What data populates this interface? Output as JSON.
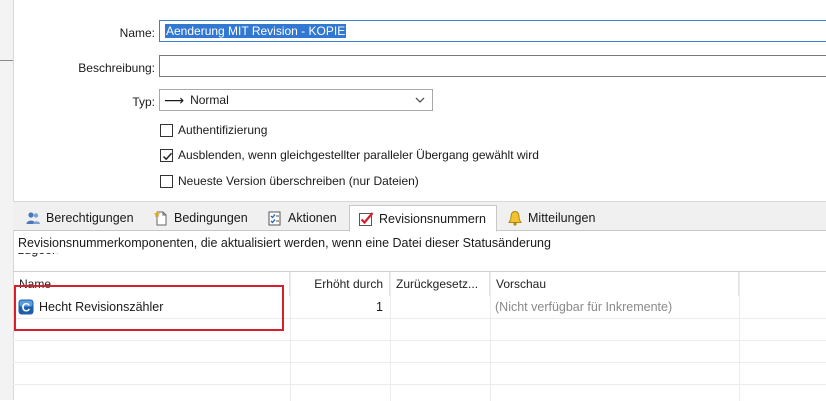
{
  "form": {
    "name_label": "Name:",
    "name_value": "Aenderung MIT Revision - KOPIE",
    "description_label": "Beschreibung:",
    "description_value": "",
    "type_label": "Typ:",
    "type_value": "Normal",
    "checkboxes": [
      {
        "label": "Authentifizierung",
        "checked": false
      },
      {
        "label": "Ausblenden, wenn gleichgestellter paralleler Übergang gewählt wird",
        "checked": true
      },
      {
        "label": "Neueste Version überschreiben (nur Dateien)",
        "checked": false
      }
    ]
  },
  "tabs": [
    {
      "label": "Berechtigungen",
      "icon": "people-icon"
    },
    {
      "label": "Bedingungen",
      "icon": "document-star-icon"
    },
    {
      "label": "Aktionen",
      "icon": "checklist-icon"
    },
    {
      "label": "Revisionsnummern",
      "icon": "red-check-icon",
      "active": true
    },
    {
      "label": "Mitteilungen",
      "icon": "bell-icon"
    }
  ],
  "panel": {
    "description": "Revisionsnummerkomponenten, die aktualisiert werden, wenn eine Datei dieser Statusänderung",
    "description_cut": "zugeordnet"
  },
  "table": {
    "columns": [
      "Name",
      "Erhöht durch",
      "Zurückgesetz...",
      "Vorschau"
    ],
    "rows": [
      {
        "name": "Hecht Revisionszähler",
        "increment": "1",
        "reset": "",
        "preview": "(Nicht verfügbar für Inkremente)"
      }
    ]
  },
  "colors": {
    "selection": "#3278d2",
    "highlight": "#d6202a",
    "accent_focus": "#3a7fd0"
  }
}
